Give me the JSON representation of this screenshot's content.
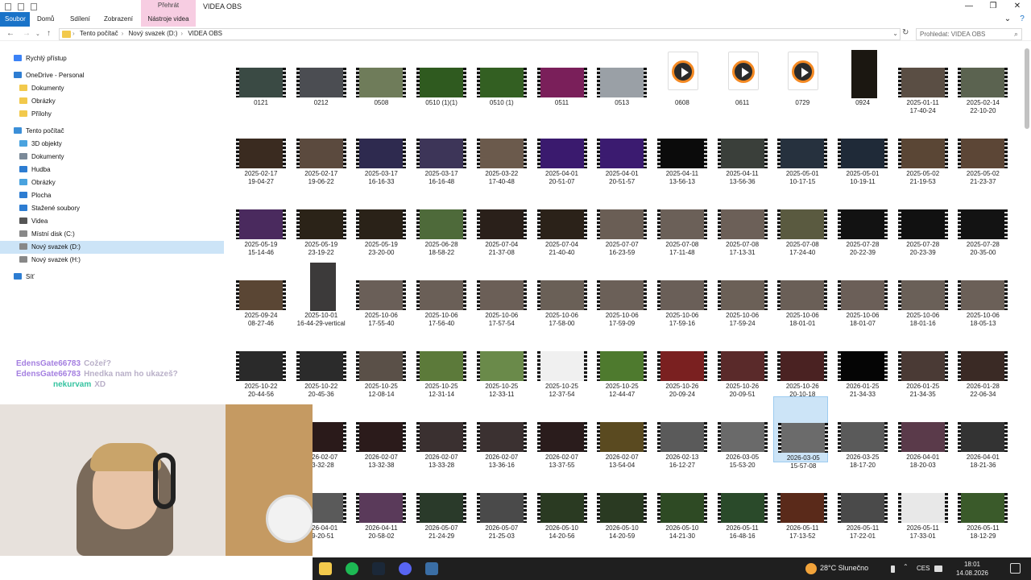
{
  "ribbon": {
    "tabs": [
      "Soubor",
      "Domů",
      "Sdílení",
      "Zobrazení"
    ],
    "context_group": "Přehrát",
    "context_tab": "Nástroje videa"
  },
  "window": {
    "title": "VIDEA OBS"
  },
  "address": {
    "crumbs": [
      "Tento počítač",
      "Nový svazek (D:)",
      "VIDEA OBS"
    ],
    "search_placeholder": "Prohledat: VIDEA OBS"
  },
  "sidebar": {
    "items": [
      {
        "label": "Rychlý přístup",
        "icon": "star-icon",
        "color": "#3b82f6"
      },
      {
        "label": "OneDrive - Personal",
        "icon": "cloud-icon",
        "color": "#2d7dd2"
      },
      {
        "label": "Dokumenty",
        "icon": "folder-icon",
        "color": "#f2c94c"
      },
      {
        "label": "Obrázky",
        "icon": "folder-icon",
        "color": "#f2c94c"
      },
      {
        "label": "Přílohy",
        "icon": "folder-icon",
        "color": "#f2c94c"
      },
      {
        "label": "Tento počítač",
        "icon": "pc-icon",
        "color": "#3b8fd8"
      },
      {
        "label": "3D objekty",
        "icon": "cube-icon",
        "color": "#4aa3df"
      },
      {
        "label": "Dokumenty",
        "icon": "document-icon",
        "color": "#7b8a99"
      },
      {
        "label": "Hudba",
        "icon": "music-icon",
        "color": "#2d7dd2"
      },
      {
        "label": "Obrázky",
        "icon": "image-icon",
        "color": "#4aa3df"
      },
      {
        "label": "Plocha",
        "icon": "desktop-icon",
        "color": "#2d7dd2"
      },
      {
        "label": "Stažené soubory",
        "icon": "download-icon",
        "color": "#2d7dd2"
      },
      {
        "label": "Videa",
        "icon": "video-icon",
        "color": "#555"
      },
      {
        "label": "Místní disk (C:)",
        "icon": "drive-icon",
        "color": "#888"
      },
      {
        "label": "Nový svazek (D:)",
        "icon": "drive-icon",
        "color": "#888"
      },
      {
        "label": "Nový svazek (H:)",
        "icon": "drive-icon",
        "color": "#888"
      },
      {
        "label": "Síť",
        "icon": "network-icon",
        "color": "#2d7dd2"
      }
    ]
  },
  "files": [
    {
      "l1": "0121",
      "l2": "",
      "kind": "video",
      "c": "#3a4a44"
    },
    {
      "l1": "0212",
      "l2": "",
      "kind": "video",
      "c": "#4b4d52"
    },
    {
      "l1": "0508",
      "l2": "",
      "kind": "video",
      "c": "#6f7c5a"
    },
    {
      "l1": "0510 (1)(1)",
      "l2": "",
      "kind": "video",
      "c": "#2f5a1f"
    },
    {
      "l1": "0510 (1)",
      "l2": "",
      "kind": "video",
      "c": "#335f22"
    },
    {
      "l1": "0511",
      "l2": "",
      "kind": "video",
      "c": "#7a1f5a"
    },
    {
      "l1": "0513",
      "l2": "",
      "kind": "video",
      "c": "#9aa0a6"
    },
    {
      "l1": "0608",
      "l2": "",
      "kind": "doc",
      "c": "#fff"
    },
    {
      "l1": "0611",
      "l2": "",
      "kind": "doc",
      "c": "#fff"
    },
    {
      "l1": "0729",
      "l2": "",
      "kind": "doc",
      "c": "#fff"
    },
    {
      "l1": "0924",
      "l2": "",
      "kind": "tall",
      "c": "#1b1711"
    },
    {
      "l1": "2025-01-11",
      "l2": "17-40-24",
      "kind": "video",
      "c": "#5a4e44"
    },
    {
      "l1": "2025-02-14",
      "l2": "22-10-20",
      "kind": "video",
      "c": "#5b6350"
    },
    {
      "l1": "2025-02-17",
      "l2": "19-04-27",
      "kind": "video",
      "c": "#3a2b20"
    },
    {
      "l1": "2025-02-17",
      "l2": "19-06-22",
      "kind": "video",
      "c": "#5b4a3e"
    },
    {
      "l1": "2025-03-17",
      "l2": "16-16-33",
      "kind": "video",
      "c": "#2e2a4f"
    },
    {
      "l1": "2025-03-17",
      "l2": "16-16-48",
      "kind": "video",
      "c": "#3d3558"
    },
    {
      "l1": "2025-03-22",
      "l2": "17-40-48",
      "kind": "video",
      "c": "#6b5a4c"
    },
    {
      "l1": "2025-04-01",
      "l2": "20-51-07",
      "kind": "video",
      "c": "#3a1a6e"
    },
    {
      "l1": "2025-04-01",
      "l2": "20-51-57",
      "kind": "video",
      "c": "#3b1b70"
    },
    {
      "l1": "2025-04-11",
      "l2": "13-56-13",
      "kind": "video",
      "c": "#0b0b0b"
    },
    {
      "l1": "2025-04-11",
      "l2": "13-56-36",
      "kind": "video",
      "c": "#3a3f3a"
    },
    {
      "l1": "2025-05-01",
      "l2": "10-17-15",
      "kind": "video",
      "c": "#26313e"
    },
    {
      "l1": "2025-05-01",
      "l2": "10-19-11",
      "kind": "video",
      "c": "#1f2a38"
    },
    {
      "l1": "2025-05-02",
      "l2": "21-19-53",
      "kind": "video",
      "c": "#5a4635"
    },
    {
      "l1": "2025-05-02",
      "l2": "21-23-37",
      "kind": "video",
      "c": "#5c4636"
    },
    {
      "l1": "2025-05-19",
      "l2": "15-14-46",
      "kind": "video",
      "c": "#4a2a5e"
    },
    {
      "l1": "2025-05-19",
      "l2": "23-19-22",
      "kind": "video",
      "c": "#2b2318"
    },
    {
      "l1": "2025-05-19",
      "l2": "23-20-00",
      "kind": "video",
      "c": "#2a2218"
    },
    {
      "l1": "2025-06-28",
      "l2": "18-58-22",
      "kind": "video",
      "c": "#4e6a3a"
    },
    {
      "l1": "2025-07-04",
      "l2": "21-37-08",
      "kind": "video",
      "c": "#2a201a"
    },
    {
      "l1": "2025-07-04",
      "l2": "21-40-40",
      "kind": "video",
      "c": "#2b2219"
    },
    {
      "l1": "2025-07-07",
      "l2": "16-23-59",
      "kind": "video",
      "c": "#6a5e55"
    },
    {
      "l1": "2025-07-08",
      "l2": "17-11-48",
      "kind": "video",
      "c": "#6b6058"
    },
    {
      "l1": "2025-07-08",
      "l2": "17-13-31",
      "kind": "video",
      "c": "#6c6058"
    },
    {
      "l1": "2025-07-08",
      "l2": "17-24-40",
      "kind": "video",
      "c": "#5a5a40"
    },
    {
      "l1": "2025-07-28",
      "l2": "20-22-39",
      "kind": "video",
      "c": "#121212"
    },
    {
      "l1": "2025-07-28",
      "l2": "20-23-39",
      "kind": "video",
      "c": "#111"
    },
    {
      "l1": "2025-07-28",
      "l2": "20-35-00",
      "kind": "video",
      "c": "#131313"
    },
    {
      "l1": "2025-09-24",
      "l2": "08-27-46",
      "kind": "video",
      "c": "#5a4634"
    },
    {
      "l1": "2025-10-01",
      "l2": "16-44-29-vertical",
      "kind": "tall",
      "c": "#3c3a3a"
    },
    {
      "l1": "2025-10-06",
      "l2": "17-55-40",
      "kind": "video",
      "c": "#6a5f58"
    },
    {
      "l1": "2025-10-06",
      "l2": "17-56-40",
      "kind": "video",
      "c": "#6a5f57"
    },
    {
      "l1": "2025-10-06",
      "l2": "17-57-54",
      "kind": "video",
      "c": "#6b5f57"
    },
    {
      "l1": "2025-10-06",
      "l2": "17-58-00",
      "kind": "video",
      "c": "#6a6057"
    },
    {
      "l1": "2025-10-06",
      "l2": "17-59-09",
      "kind": "video",
      "c": "#6b6058"
    },
    {
      "l1": "2025-10-06",
      "l2": "17-59-16",
      "kind": "video",
      "c": "#6a5f58"
    },
    {
      "l1": "2025-10-06",
      "l2": "17-59-24",
      "kind": "video",
      "c": "#6b6057"
    },
    {
      "l1": "2025-10-06",
      "l2": "18-01-01",
      "kind": "video",
      "c": "#6a5f57"
    },
    {
      "l1": "2025-10-06",
      "l2": "18-01-07",
      "kind": "video",
      "c": "#6b5f58"
    },
    {
      "l1": "2025-10-06",
      "l2": "18-01-16",
      "kind": "video",
      "c": "#6a6058"
    },
    {
      "l1": "2025-10-06",
      "l2": "18-05-13",
      "kind": "video",
      "c": "#6b6058"
    },
    {
      "l1": "2025-10-22",
      "l2": "20-44-56",
      "kind": "video",
      "c": "#2a2a2a"
    },
    {
      "l1": "2025-10-22",
      "l2": "20-45-36",
      "kind": "video",
      "c": "#2b2b2b"
    },
    {
      "l1": "2025-10-25",
      "l2": "12-08-14",
      "kind": "video",
      "c": "#5a5048"
    },
    {
      "l1": "2025-10-25",
      "l2": "12-31-14",
      "kind": "video",
      "c": "#5c7a3a"
    },
    {
      "l1": "2025-10-25",
      "l2": "12-33-11",
      "kind": "video",
      "c": "#6a8a4a"
    },
    {
      "l1": "2025-10-25",
      "l2": "12-37-54",
      "kind": "video",
      "c": "#f0f0f0"
    },
    {
      "l1": "2025-10-25",
      "l2": "12-44-47",
      "kind": "video",
      "c": "#4e7a2e"
    },
    {
      "l1": "2025-10-26",
      "l2": "20-09-24",
      "kind": "video",
      "c": "#7a2020"
    },
    {
      "l1": "2025-10-26",
      "l2": "20-09-51",
      "kind": "video",
      "c": "#5a2a2a"
    },
    {
      "l1": "2025-10-26",
      "l2": "20-10-18",
      "kind": "video",
      "c": "#4a2222"
    },
    {
      "l1": "2026-01-25",
      "l2": "21-34-33",
      "kind": "video",
      "c": "#050505"
    },
    {
      "l1": "2026-01-25",
      "l2": "21-34-35",
      "kind": "video",
      "c": "#4a3a35"
    },
    {
      "l1": "2026-01-28",
      "l2": "22-06-34",
      "kind": "video",
      "c": "#3a2a25"
    },
    {
      "l1": "2026-02-07",
      "l2": "13-32-28",
      "kind": "video",
      "c": "#2a1a1a"
    },
    {
      "l1": "2026-02-07",
      "l2": "13-32-38",
      "kind": "video",
      "c": "#2b1b1b"
    },
    {
      "l1": "2026-02-07",
      "l2": "13-33-28",
      "kind": "video",
      "c": "#3a3030"
    },
    {
      "l1": "2026-02-07",
      "l2": "13-36-16",
      "kind": "video",
      "c": "#3b3131"
    },
    {
      "l1": "2026-02-07",
      "l2": "13-37-55",
      "kind": "video",
      "c": "#2a1c1c"
    },
    {
      "l1": "2026-02-07",
      "l2": "13-54-04",
      "kind": "video",
      "c": "#5a4a20"
    },
    {
      "l1": "2026-02-13",
      "l2": "16-12-27",
      "kind": "video",
      "c": "#5a5a5a"
    },
    {
      "l1": "2026-03-05",
      "l2": "15-53-20",
      "kind": "video",
      "c": "#6a6a6a"
    },
    {
      "l1": "2026-03-05",
      "l2": "15-57-08",
      "kind": "video",
      "c": "#6b6b6b"
    },
    {
      "l1": "2026-03-25",
      "l2": "18-17-20",
      "kind": "video",
      "c": "#5a5a5a"
    },
    {
      "l1": "2026-04-01",
      "l2": "18-20-03",
      "kind": "video",
      "c": "#5a3a4a"
    },
    {
      "l1": "2026-04-01",
      "l2": "18-21-36",
      "kind": "video",
      "c": "#333"
    },
    {
      "l1": "2026-04-01",
      "l2": "19-20-51",
      "kind": "video",
      "c": "#5a5a5a"
    },
    {
      "l1": "2026-04-11",
      "l2": "20-58-02",
      "kind": "video",
      "c": "#5a3a5a"
    },
    {
      "l1": "2026-05-07",
      "l2": "21-24-29",
      "kind": "video",
      "c": "#2a3a2a"
    },
    {
      "l1": "2026-05-07",
      "l2": "21-25-03",
      "kind": "video",
      "c": "#4a4a4a"
    },
    {
      "l1": "2026-05-10",
      "l2": "14-20-56",
      "kind": "video",
      "c": "#2a3a22"
    },
    {
      "l1": "2026-05-10",
      "l2": "14-20-59",
      "kind": "video",
      "c": "#2a3a22"
    },
    {
      "l1": "2026-05-10",
      "l2": "14-21-30",
      "kind": "video",
      "c": "#2e4a24"
    },
    {
      "l1": "2026-05-11",
      "l2": "16-48-16",
      "kind": "video",
      "c": "#2a4a2a"
    },
    {
      "l1": "2026-05-11",
      "l2": "17-13-52",
      "kind": "video",
      "c": "#5a2a1a"
    },
    {
      "l1": "2026-05-11",
      "l2": "17-22-01",
      "kind": "video",
      "c": "#4a4a4a"
    },
    {
      "l1": "2026-05-11",
      "l2": "17-33-01",
      "kind": "video",
      "c": "#e8e8e8"
    },
    {
      "l1": "2026-05-11",
      "l2": "18-12-29",
      "kind": "video",
      "c": "#3a5a2a"
    }
  ],
  "chat": [
    {
      "user": "EdensGate66783",
      "msg": "Cožeř?"
    },
    {
      "user": "EdensGate66783",
      "msg": "Hnedka nam ho ukazeš?"
    },
    {
      "user": "nekurvam",
      "msg": "XD"
    }
  ],
  "taskbar": {
    "weather": "28°C  Slunečno",
    "lang": "CES",
    "time": "18:01",
    "date": "14.08.2026",
    "apps": [
      {
        "icon": "file-explorer-icon",
        "color": "#f2c94c"
      },
      {
        "icon": "spotify-icon",
        "color": "#1db954"
      },
      {
        "icon": "steam-icon",
        "color": "#1b2838"
      },
      {
        "icon": "discord-icon",
        "color": "#5865f2"
      },
      {
        "icon": "game-icon",
        "color": "#3a6ea5"
      }
    ]
  }
}
